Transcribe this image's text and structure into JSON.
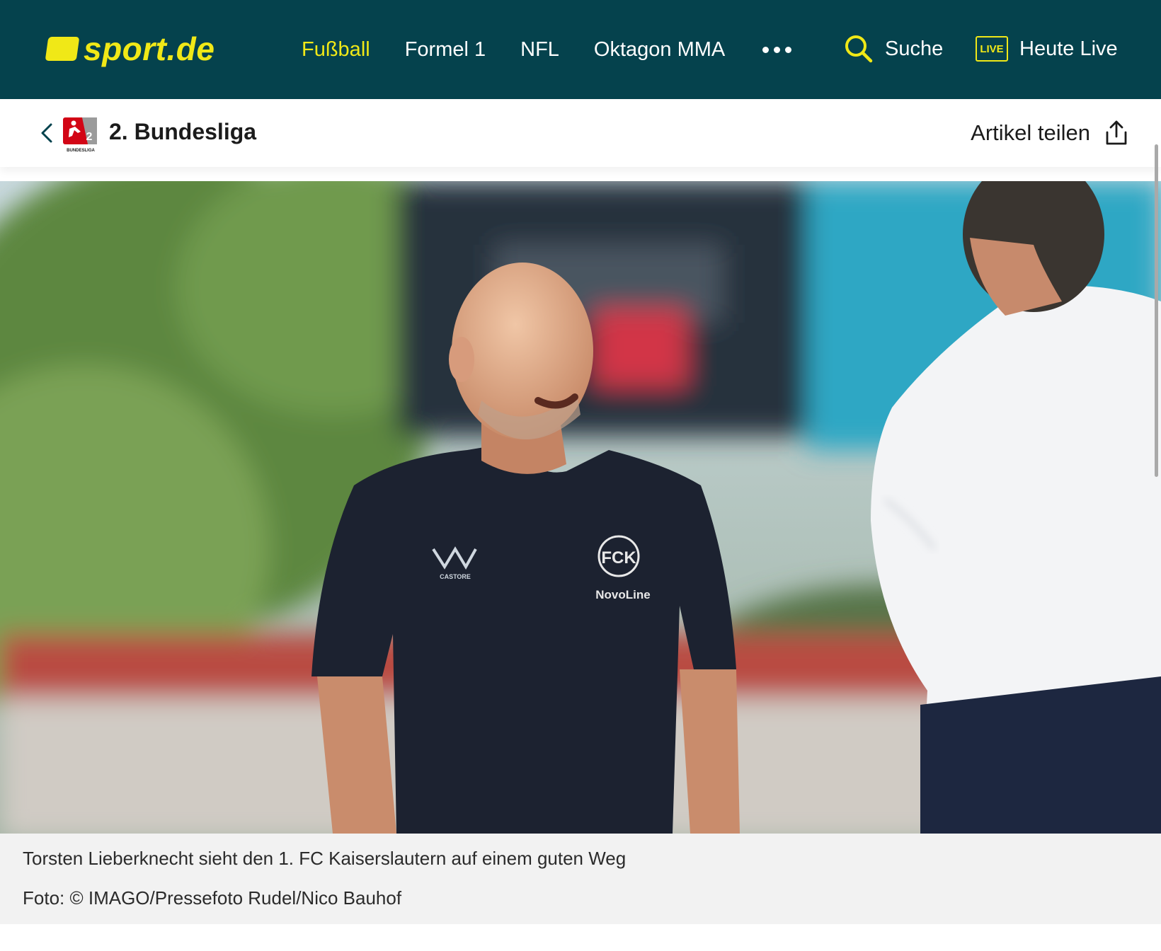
{
  "header": {
    "logo_text": "sport.de",
    "nav": [
      {
        "label": "Fußball",
        "active": true
      },
      {
        "label": "Formel 1",
        "active": false
      },
      {
        "label": "NFL",
        "active": false
      },
      {
        "label": "Oktagon MMA",
        "active": false
      }
    ],
    "more_icon": "ellipsis-icon",
    "search_label": "Suche",
    "live_badge": "LIVE",
    "live_label": "Heute Live"
  },
  "subheader": {
    "back_icon": "chevron-left-icon",
    "league_title": "2. Bundesliga",
    "share_label": "Artikel teilen",
    "share_icon": "share-upload-icon"
  },
  "article": {
    "caption": "Torsten Lieberknecht sieht den 1. FC Kaiserslautern auf einem guten Weg",
    "credit": "Foto: © IMAGO/Pressefoto Rudel/Nico Bauhof"
  },
  "colors": {
    "brand_dark": "#05424d",
    "brand_yellow": "#f0e817"
  }
}
